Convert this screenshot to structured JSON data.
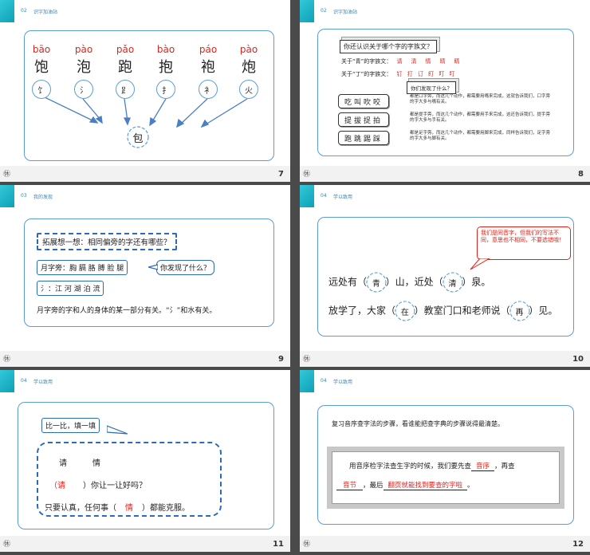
{
  "slides": [
    {
      "num": "7",
      "footer_logo": "㊡",
      "sec_num": "02",
      "sec_title": "识字加油站",
      "pinyin": [
        "bāo",
        "pào",
        "pǎo",
        "bào",
        "páo",
        "pào"
      ],
      "chars": [
        "饱",
        "泡",
        "跑",
        "抱",
        "袍",
        "炮"
      ],
      "radicals": [
        "饣",
        "氵",
        "⻊",
        "扌",
        "衤",
        "火"
      ],
      "center": "包"
    },
    {
      "num": "8",
      "footer_logo": "㊡",
      "sec_num": "02",
      "sec_title": "识字加油站",
      "question": "你还认识关于哪个字的字族文？",
      "line1_label": "关于“青”的字族文：",
      "line1_words": "请　清　情　晴　睛",
      "line2_label": "关于“丁”的字族文：",
      "line2_words": "钉 打 订 盯 叮 叮",
      "ask": "你们发现了什么？",
      "groups": [
        {
          "words": "吃叫吹咬",
          "desc": "都是口字旁，而这几个动作，都需要用嘴来完成，这就告诉我们，口字旁的字大多与嘴有关。"
        },
        {
          "words": "提拔捉拍",
          "desc": "都是提手旁，而这几个动作，都需要用手来完成，这还告诉我们，提手旁的字大多与手有关。"
        },
        {
          "words": "跑跳踢踩",
          "desc": "都是足字旁，而这几个动作，都需要用脚来完成，同样告诉我们，足字旁的字大多与脚有关。"
        }
      ]
    },
    {
      "num": "9",
      "footer_logo": "㊡",
      "sec_num": "03",
      "sec_title": "我的发现",
      "think": "拓展想一想：相同偏旁的字还有哪些？",
      "yue": "月字旁：胸 膈 胳 膊 脸 腿",
      "found": "你发现了什么？",
      "shui": "氵：江 河 湖 泊 流",
      "conclusion": "月字旁的字和人的身体的某一部分有关。“氵”和水有关。"
    },
    {
      "num": "10",
      "footer_logo": "㊡",
      "sec_num": "04",
      "sec_title": "学以致用",
      "callout": "我们是同音字，但我们的写法不同，意思也不相同，不要选错哦！",
      "s1": [
        "远处有（",
        "）山，近处（",
        "）泉。"
      ],
      "s1_fill": [
        "青",
        "清"
      ],
      "s2": [
        "放学了，大家（",
        "）教室门口和老师说（",
        "）见。"
      ],
      "s2_fill": [
        "在",
        "再"
      ]
    },
    {
      "num": "11",
      "footer_logo": "㊡",
      "sec_num": "04",
      "sec_title": "学以致用",
      "compare": "比一比，填一填",
      "pair": [
        "请",
        "情"
      ],
      "l1_pre": "（",
      "l1_fill": "请",
      "l1_post": "）你让一让好吗？",
      "l2_pre": "只要认真，任何事（",
      "l2_fill": "情",
      "l2_post": "）都能克服。"
    },
    {
      "num": "12",
      "footer_logo": "㊡",
      "sec_num": "04",
      "sec_title": "学以致用",
      "review": "复习音序查字法的步骤，看谁能把查字典的步骤说得最清楚。",
      "p1": "用音序检字法查生字的时候，我们要先查",
      "f1": "音序",
      "p2": "，再查",
      "f2": "音节",
      "p3": "，最后",
      "f3": "翻页就能找到要查的字啦",
      "p4": "。"
    }
  ]
}
